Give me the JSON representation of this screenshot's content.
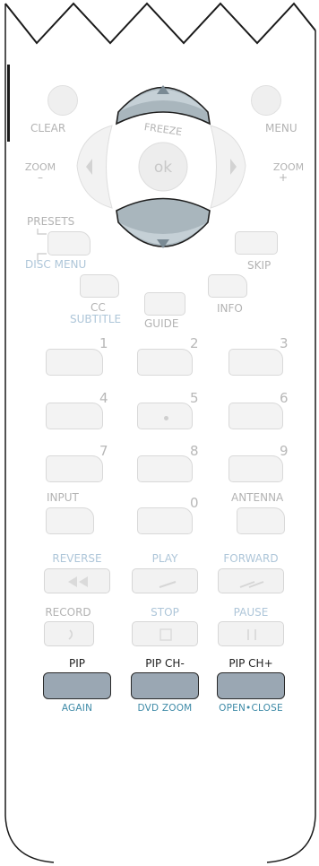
{
  "dpad": {
    "freeze": "FREEZE",
    "ok": "ok"
  },
  "top": {
    "clear": "CLEAR",
    "menu": "MENU",
    "zoom_minus": [
      "ZOOM",
      "–"
    ],
    "zoom_plus": [
      "ZOOM",
      "+"
    ]
  },
  "mid": {
    "presets": "PRESETS",
    "disc_menu": "DISC MENU",
    "skip": "SKIP",
    "cc": "CC",
    "subtitle": "SUBTITLE",
    "guide": "GUIDE",
    "info": "INFO"
  },
  "numpad": {
    "digits": [
      "1",
      "2",
      "3",
      "4",
      "5",
      "6",
      "7",
      "8",
      "9",
      "0"
    ],
    "input": "INPUT",
    "antenna": "ANTENNA"
  },
  "transport": {
    "reverse": "REVERSE",
    "play": "PLAY",
    "forward": "FORWARD",
    "record": "RECORD",
    "stop": "STOP",
    "pause": "PAUSE"
  },
  "pip": {
    "pip": "PIP",
    "pip_ch_minus": "PIP CH-",
    "pip_ch_plus": "PIP CH+",
    "again": "AGAIN",
    "dvd_zoom": "DVD ZOOM",
    "open_close": "OPEN•CLOSE"
  },
  "colors": {
    "active_button": "#9aa7b3",
    "teal_label": "#3e8aa7",
    "ghost_text": "#b3b3b3",
    "dpad_up_down": "#a9b6bd"
  }
}
